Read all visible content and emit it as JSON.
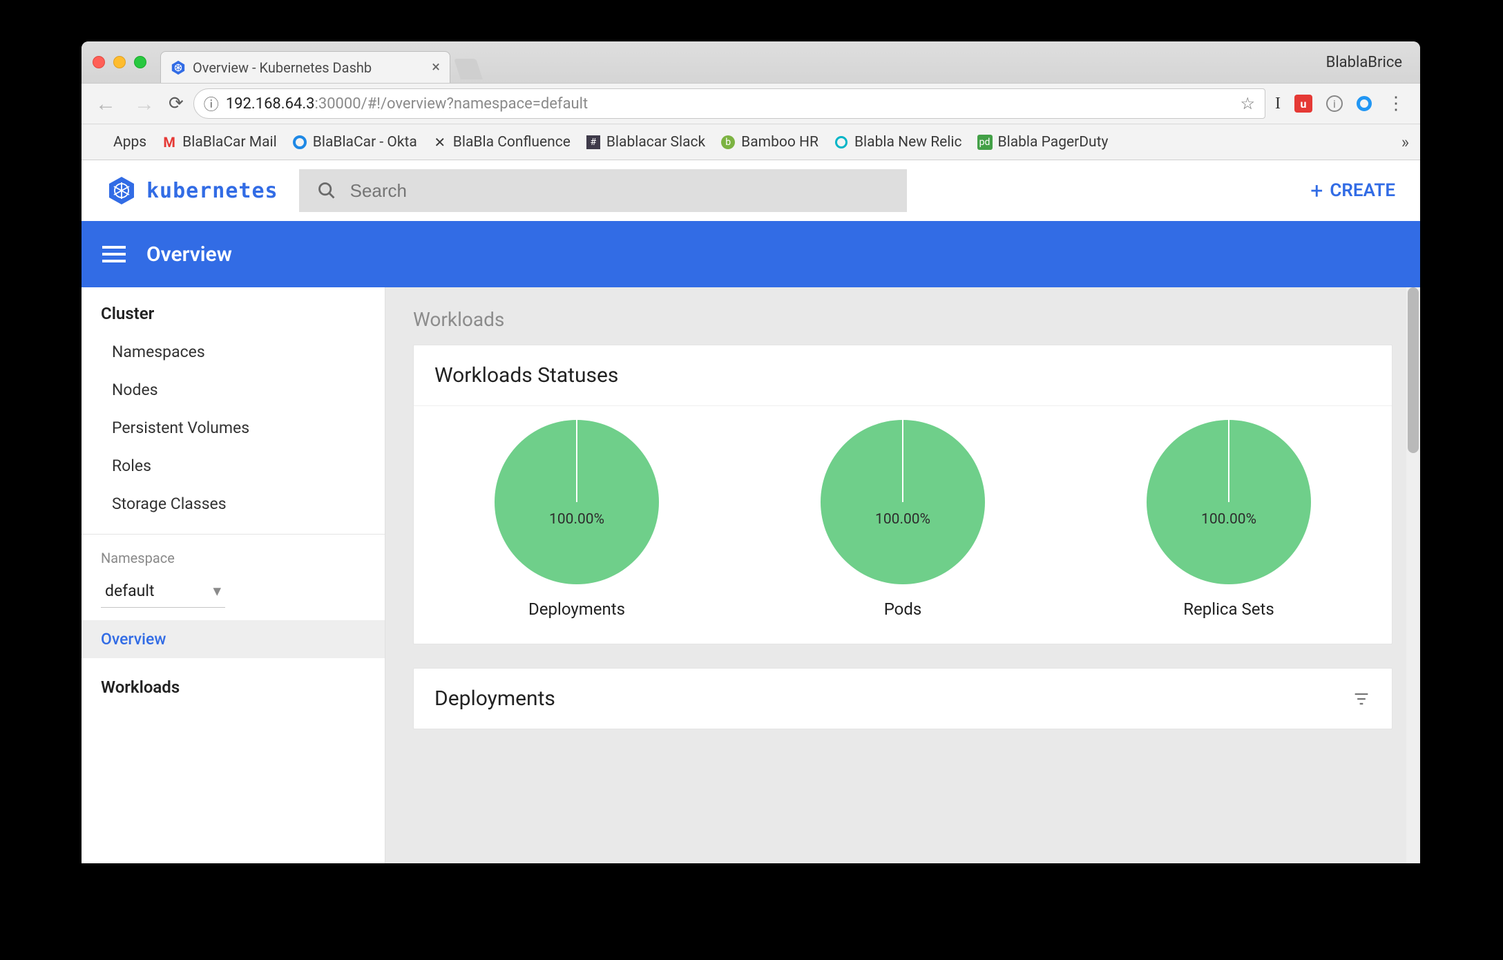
{
  "browser": {
    "tab_title": "Overview - Kubernetes Dashb",
    "profile": "BlablaBrice",
    "url_host": "192.168.64.3",
    "url_rest": ":30000/#!/overview?namespace=default",
    "bookmarks": [
      {
        "label": "Apps"
      },
      {
        "label": "BlaBlaCar Mail"
      },
      {
        "label": "BlaBlaCar - Okta"
      },
      {
        "label": "BlaBla Confluence"
      },
      {
        "label": "Blablacar Slack"
      },
      {
        "label": "Bamboo HR"
      },
      {
        "label": "Blabla New Relic"
      },
      {
        "label": "Blabla PagerDuty"
      }
    ]
  },
  "header": {
    "brand": "kubernetes",
    "search_placeholder": "Search",
    "create_label": "CREATE"
  },
  "bluebar": {
    "page_title": "Overview"
  },
  "sidebar": {
    "cluster_title": "Cluster",
    "cluster_items": [
      "Namespaces",
      "Nodes",
      "Persistent Volumes",
      "Roles",
      "Storage Classes"
    ],
    "namespace_label": "Namespace",
    "namespace_value": "default",
    "overview_label": "Overview",
    "workloads_title": "Workloads"
  },
  "main": {
    "section_label": "Workloads",
    "statuses_card_title": "Workloads Statuses",
    "deployments_card_title": "Deployments"
  },
  "chart_data": {
    "type": "pie",
    "charts": [
      {
        "name": "Deployments",
        "value": 100.0,
        "display": "100.00%"
      },
      {
        "name": "Pods",
        "value": 100.0,
        "display": "100.00%"
      },
      {
        "name": "Replica Sets",
        "value": 100.0,
        "display": "100.00%"
      }
    ],
    "color": "#6fcf8a"
  }
}
